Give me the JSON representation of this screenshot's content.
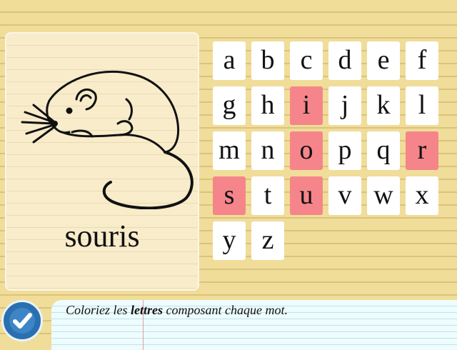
{
  "card": {
    "word": "souris",
    "image": "mouse-drawing"
  },
  "letters": [
    {
      "letter": "a",
      "selected": false
    },
    {
      "letter": "b",
      "selected": false
    },
    {
      "letter": "c",
      "selected": false
    },
    {
      "letter": "d",
      "selected": false
    },
    {
      "letter": "e",
      "selected": false
    },
    {
      "letter": "f",
      "selected": false
    },
    {
      "letter": "g",
      "selected": false
    },
    {
      "letter": "h",
      "selected": false
    },
    {
      "letter": "i",
      "selected": true
    },
    {
      "letter": "j",
      "selected": false
    },
    {
      "letter": "k",
      "selected": false
    },
    {
      "letter": "l",
      "selected": false
    },
    {
      "letter": "m",
      "selected": false
    },
    {
      "letter": "n",
      "selected": false
    },
    {
      "letter": "o",
      "selected": true
    },
    {
      "letter": "p",
      "selected": false
    },
    {
      "letter": "q",
      "selected": false
    },
    {
      "letter": "r",
      "selected": true
    },
    {
      "letter": "s",
      "selected": true
    },
    {
      "letter": "t",
      "selected": false
    },
    {
      "letter": "u",
      "selected": true
    },
    {
      "letter": "v",
      "selected": false
    },
    {
      "letter": "w",
      "selected": false
    },
    {
      "letter": "x",
      "selected": false
    },
    {
      "letter": "y",
      "selected": false
    },
    {
      "letter": "z",
      "selected": false
    }
  ],
  "instruction": {
    "before": "Coloriez les ",
    "bold": "lettres",
    "after": " composant chaque mot."
  },
  "colors": {
    "selected_tile": "#f5858a",
    "tile": "#ffffff",
    "background": "#f0dd9a",
    "check_button": "#2a6fb0"
  },
  "icons": {
    "validate": "check-icon"
  }
}
